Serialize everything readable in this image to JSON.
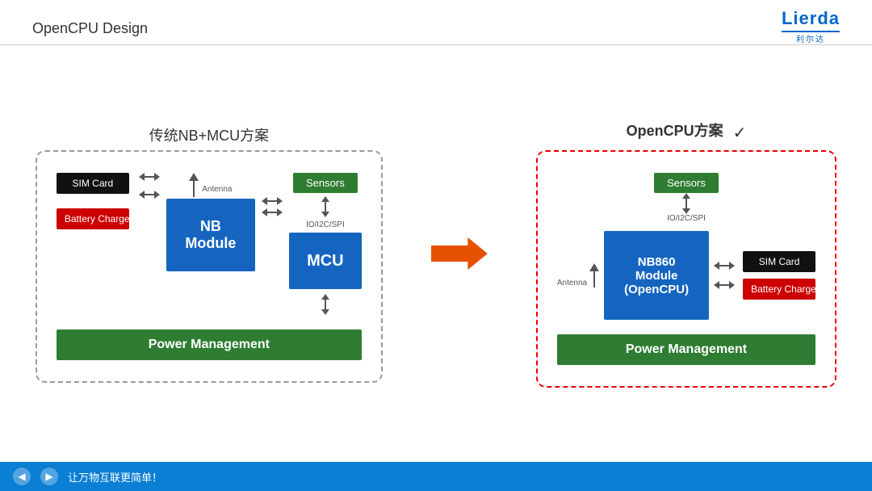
{
  "header": {
    "title": "OpenCPU Design"
  },
  "logo": {
    "name": "Lierda",
    "subtitle": "利尔达"
  },
  "left_diagram": {
    "title": "传统NB+MCU方案",
    "antenna_label": "Antenna",
    "sensors_label": "Sensors",
    "io_label": "IO/I2C/SPI",
    "nb_label": "NB\nModule",
    "mcu_label": "MCU",
    "sim_label": "SIM Card",
    "battery_label": "Battery Charge",
    "power_label": "Power Management"
  },
  "right_diagram": {
    "title": "OpenCPU方案",
    "checkmark": "✓",
    "antenna_label": "Antenna",
    "sensors_label": "Sensors",
    "io_label": "IO/I2C/SPI",
    "nb_label": "NB860\nModule\n(OpenCPU)",
    "sim_label": "SIM Card",
    "battery_label": "Battery Charge",
    "power_label": "Power Management"
  },
  "footer": {
    "text": "让万物互联更简单！",
    "prev_label": "◀",
    "next_label": "▶"
  }
}
